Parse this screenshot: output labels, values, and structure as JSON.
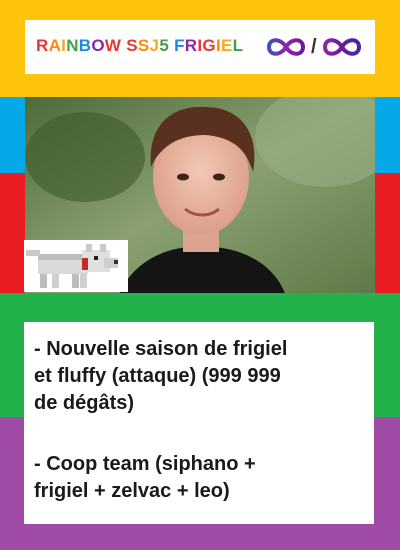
{
  "card": {
    "title": "RAINBOW SSJ5 FRIGIEL",
    "title_colors": [
      "#E53935",
      "#FB8C00",
      "#F9A825",
      "#43A047",
      "#1E88E5",
      "#8E24AA",
      "#E53935"
    ],
    "stats": {
      "attack_icon": "infinity-icon",
      "separator": "/",
      "health_icon": "infinity-icon"
    },
    "image_icon": "portrait-photo",
    "companion_icon": "wolf-icon",
    "description": {
      "ability1_line1": "- Nouvelle saison de frigiel",
      "ability1_line2": "et fluffy (attaque) (999 999",
      "ability1_line3": "de dégâts)",
      "ability2_line1": "- Coop team (siphano +",
      "ability2_line2": "frigiel + zelvac + leo)"
    },
    "band_colors": [
      "#FEC40C",
      "#06A9E8",
      "#EC1C24",
      "#23B14C",
      "#A04BA6"
    ]
  }
}
